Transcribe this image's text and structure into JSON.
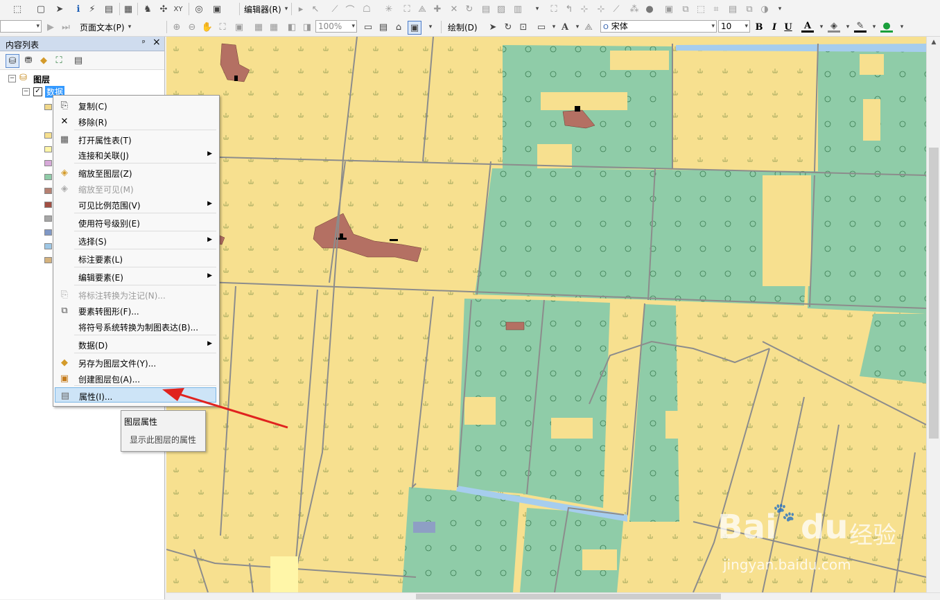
{
  "toolbar1": {
    "editor_label": "编辑器(R)"
  },
  "toolbar2": {
    "page_text_label": "页面文本(P)",
    "zoom_value": "100%",
    "draw_label": "绘制(D)",
    "font_name": "宋体",
    "font_size": "10",
    "bold": "B",
    "italic": "I",
    "underline": "U",
    "font_color_glyph": "A",
    "text_tool_glyph": "A"
  },
  "toc": {
    "title": "内容列表",
    "pin_glyph": "ᵖ",
    "close_glyph": "×",
    "root_label": "图层",
    "layer_label": "数据",
    "swatch_colors": [
      "#f1d88a",
      "#f7e08f",
      "#fff6a8",
      "#d7a9d9",
      "#8fcca8",
      "#b68071",
      "#a34f43",
      "#a6a6a6",
      "#7f98c6",
      "#9ec7e6",
      "#d4b27d"
    ]
  },
  "context_menu": {
    "items": [
      {
        "label": "复制(C)",
        "icon": "copy-icon",
        "disabled": false,
        "submenu": false
      },
      {
        "label": "移除(R)",
        "icon": "remove-icon",
        "disabled": false,
        "submenu": false
      },
      {
        "label": "打开属性表(T)",
        "icon": "table-icon",
        "disabled": false,
        "submenu": false
      },
      {
        "label": "连接和关联(J)",
        "icon": "",
        "disabled": false,
        "submenu": true
      },
      {
        "label": "缩放至图层(Z)",
        "icon": "zoom-to-layer-icon",
        "disabled": false,
        "submenu": false
      },
      {
        "label": "缩放至可见(M)",
        "icon": "zoom-to-visible-icon",
        "disabled": true,
        "submenu": false
      },
      {
        "label": "可见比例范围(V)",
        "icon": "",
        "disabled": false,
        "submenu": true
      },
      {
        "label": "使用符号级别(E)",
        "icon": "",
        "disabled": false,
        "submenu": false
      },
      {
        "label": "选择(S)",
        "icon": "",
        "disabled": false,
        "submenu": true
      },
      {
        "label": "标注要素(L)",
        "icon": "",
        "disabled": false,
        "submenu": false
      },
      {
        "label": "编辑要素(E)",
        "icon": "",
        "disabled": false,
        "submenu": true
      },
      {
        "label": "将标注转换为注记(N)...",
        "icon": "convert-label-icon",
        "disabled": true,
        "submenu": false
      },
      {
        "label": "要素转图形(F)...",
        "icon": "feature-to-graphic-icon",
        "disabled": false,
        "submenu": false
      },
      {
        "label": "将符号系统转换为制图表达(B)...",
        "icon": "",
        "disabled": false,
        "submenu": false
      },
      {
        "label": "数据(D)",
        "icon": "",
        "disabled": false,
        "submenu": true
      },
      {
        "label": "另存为图层文件(Y)...",
        "icon": "layer-file-icon",
        "disabled": false,
        "submenu": false
      },
      {
        "label": "创建图层包(A)...",
        "icon": "layer-package-icon",
        "disabled": false,
        "submenu": false
      },
      {
        "label": "属性(I)...",
        "icon": "properties-icon",
        "disabled": false,
        "submenu": false,
        "highlighted": true
      }
    ]
  },
  "tooltip": {
    "title": "图层属性",
    "description": "显示此图层的属性"
  },
  "watermark": {
    "brand": "Bai",
    "brand2": "du",
    "cn": "经验",
    "url": "jingyan.baidu.com"
  },
  "colors": {
    "farmland": "#f7e08f",
    "forest": "#8fcca8",
    "residential": "#b47063",
    "water": "#a6cdee",
    "road": "#8c8c8c",
    "arrow": "#e0231f",
    "highlight": "#cde4f7"
  }
}
